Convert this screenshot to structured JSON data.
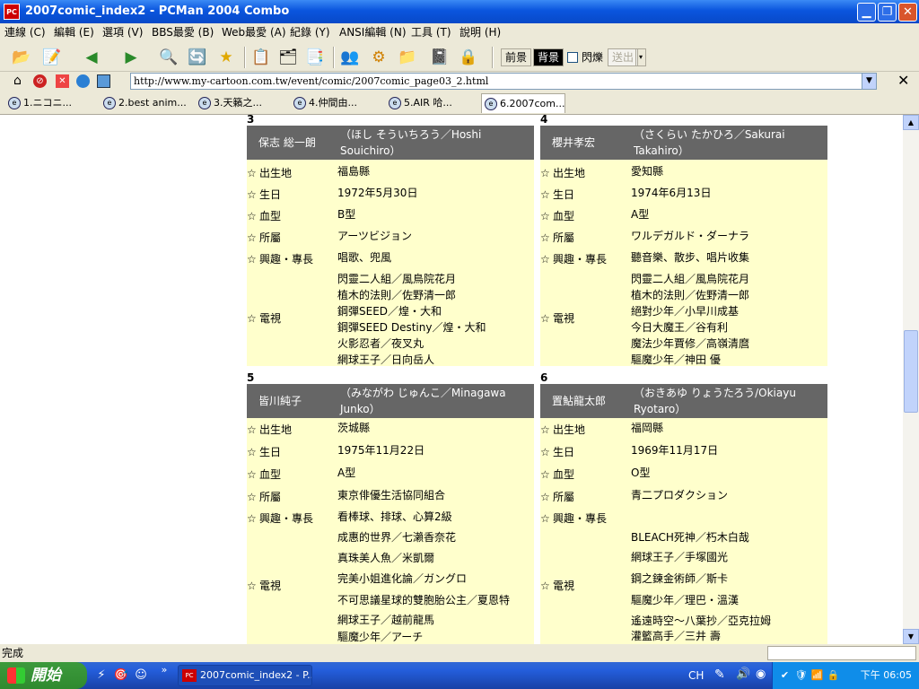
{
  "window": {
    "app_icon": "PC",
    "title": "2007comic_index2 - PCMan 2004 Combo",
    "min_glyph": "▁",
    "max_glyph": "❐",
    "close_glyph": "✕"
  },
  "menu": [
    "連線 (C)",
    "編輯 (E)",
    "選項 (V)",
    "BBS最愛 (B)",
    "Web最愛 (A)",
    "紀錄 (Y)",
    "ANSI編輯 (N)",
    "工具 (T)",
    "說明 (H)"
  ],
  "toolbar": {
    "icons": [
      "📂",
      "📝",
      "◀",
      "▶",
      "🔍",
      "🔄",
      "★",
      "📋",
      "🗂",
      "📑",
      "👥",
      "⚙",
      "📁",
      "📓",
      "🔒"
    ],
    "fg_label": "前景",
    "bg_label": "背景",
    "blink_label": "閃爍",
    "send_label": "送出"
  },
  "address": {
    "url": "http://www.my-cartoon.com.tw/event/comic/2007comic_page03_2.html",
    "close_glyph": "✕"
  },
  "tabs": [
    "1.ニコニ...",
    "2.best anim...",
    "3.天籟之...",
    "4.仲間由...",
    "5.AIR 哈...",
    "6.2007com..."
  ],
  "cards": [
    {
      "number": "3",
      "name": "保志 総一朗",
      "reading": "（ほし そういちろう／Hoshi Souichiro）",
      "rows": [
        {
          "label": "出生地",
          "lines": [
            "福島縣"
          ]
        },
        {
          "label": "生日",
          "lines": [
            "1972年5月30日"
          ]
        },
        {
          "label": "血型",
          "lines": [
            "B型"
          ]
        },
        {
          "label": "所屬",
          "lines": [
            "アーツビジョン"
          ]
        },
        {
          "label": "興趣・專長",
          "lines": [
            "唱歌、兜風"
          ]
        },
        {
          "label": "電視",
          "lines": [
            "閃靈二人組／風鳥院花月",
            "植木的法則／佐野清一郎",
            "鋼彈SEED／煌・大和",
            "鋼彈SEED Destiny／煌・大和",
            "火影忍者／夜叉丸",
            "網球王子／日向岳人"
          ]
        }
      ]
    },
    {
      "number": "4",
      "name": "櫻井孝宏",
      "reading": "（さくらい たかひろ／Sakurai Takahiro）",
      "rows": [
        {
          "label": "出生地",
          "lines": [
            "愛知縣"
          ]
        },
        {
          "label": "生日",
          "lines": [
            "1974年6月13日"
          ]
        },
        {
          "label": "血型",
          "lines": [
            "A型"
          ]
        },
        {
          "label": "所屬",
          "lines": [
            "ワルデガルド・ダーナラ"
          ]
        },
        {
          "label": "興趣・專長",
          "lines": [
            "聽音樂、散步、唱片收集"
          ]
        },
        {
          "label": "電視",
          "lines": [
            "閃靈二人組／風鳥院花月",
            "植木的法則／佐野清一郎",
            "絕對少年／小早川成基",
            "今日大魔王／谷有利",
            "魔法少年賈修／高嶺清麿",
            "驅魔少年／神田 優"
          ]
        }
      ]
    },
    {
      "number": "5",
      "name": "皆川純子",
      "reading": "（みながわ じゅんこ／Minagawa Junko）",
      "rows": [
        {
          "label": "出生地",
          "lines": [
            "茨城縣"
          ]
        },
        {
          "label": "生日",
          "lines": [
            "1975年11月22日"
          ]
        },
        {
          "label": "血型",
          "lines": [
            "A型"
          ]
        },
        {
          "label": "所屬",
          "lines": [
            "東京俳優生活協同組合"
          ]
        },
        {
          "label": "興趣・專長",
          "lines": [
            "看棒球、排球、心算2級"
          ]
        },
        {
          "label": "電視",
          "lines": [
            "成惠的世界／七瀨香奈花",
            "真珠美人魚／米凱爾",
            "完美小姐進化論／ガングロ",
            "不可思議星球的雙胞胎公主／夏恩特",
            "網球王子／越前龍馬",
            "驅魔少年／アーチ"
          ]
        }
      ]
    },
    {
      "number": "6",
      "name": "置鮎龍太郎",
      "reading": "（おきあゆ りょうたろう/Okiayu Ryotaro）",
      "rows": [
        {
          "label": "出生地",
          "lines": [
            "福岡縣"
          ]
        },
        {
          "label": "生日",
          "lines": [
            "1969年11月17日"
          ]
        },
        {
          "label": "血型",
          "lines": [
            "O型"
          ]
        },
        {
          "label": "所屬",
          "lines": [
            "青二プロダクション"
          ]
        },
        {
          "label": "興趣・專長",
          "lines": [
            ""
          ]
        },
        {
          "label": "電視",
          "lines": [
            "BLEACH死神／朽木白哉",
            "網球王子／手塚國光",
            "鋼之鍊金術師／斯卡",
            "驅魔少年／理巴・溫漢",
            "遙遠時空～八葉抄／亞克拉姆",
            "灌籃高手／三井 壽"
          ]
        }
      ]
    }
  ],
  "star_glyph": "☆",
  "status": {
    "text": "完成"
  },
  "taskbar": {
    "start_label": "開始",
    "quick_launch": [
      "⚡",
      "🎯",
      "☺"
    ],
    "more_glyph": "»",
    "task_icon": "PC",
    "task_label": "2007comic_index2 - P...",
    "lang": "CH",
    "clock": "下午 06:05",
    "tray_icons": [
      "✎",
      "🔊",
      "◉",
      "✔",
      "🛡",
      "📶",
      "🔒"
    ]
  }
}
